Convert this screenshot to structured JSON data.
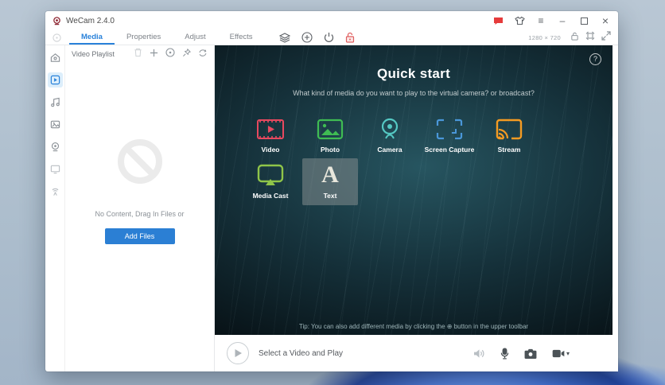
{
  "window": {
    "title": "WeCam 2.4.0",
    "resolution": "1280 × 720",
    "controls": {
      "minimize": "–",
      "maximize": "",
      "close": "×",
      "menu": "≡"
    }
  },
  "tabs": [
    {
      "label": "Media",
      "active": true
    },
    {
      "label": "Properties",
      "active": false
    },
    {
      "label": "Adjust",
      "active": false
    },
    {
      "label": "Effects",
      "active": false
    }
  ],
  "toolbar_icons": [
    "layers-icon",
    "add-circle-icon",
    "power-icon",
    "lock-red-icon"
  ],
  "playlist": {
    "title": "Video Playlist",
    "header_icons": [
      "trash-icon",
      "plus-icon",
      "record-icon",
      "pin-icon",
      "repeat-icon"
    ],
    "empty_text": "No Content, Drag In Files or",
    "add_button_label": "Add Files"
  },
  "preview": {
    "title": "Quick start",
    "subtitle": "What kind of media do you want to play to the virtual camera? or broadcast?",
    "tip": "Tip: You can also add different media by clicking the ⊕ button in the upper toolbar",
    "help_label": "?",
    "media_types": [
      {
        "label": "Video",
        "icon": "film-icon",
        "color": "#e8495f",
        "selected": false
      },
      {
        "label": "Photo",
        "icon": "photo-icon",
        "color": "#3fbc53",
        "selected": false
      },
      {
        "label": "Camera",
        "icon": "webcam-icon",
        "color": "#55c9c4",
        "selected": false
      },
      {
        "label": "Screen Capture",
        "icon": "screen-capture-icon",
        "color": "#4a97d9",
        "selected": false
      },
      {
        "label": "Stream",
        "icon": "stream-icon",
        "color": "#f59b22",
        "selected": false
      },
      {
        "label": "Media Cast",
        "icon": "cast-icon",
        "color": "#8fc549",
        "selected": false
      },
      {
        "label": "Text",
        "icon": "text-icon",
        "color": "#e9e7dc",
        "selected": true,
        "glyph": "A"
      }
    ]
  },
  "bottom_bar": {
    "status": "Select a Video and Play",
    "icons": [
      "speaker-muted-icon",
      "microphone-icon",
      "snapshot-camera-icon",
      "video-camera-icon"
    ]
  },
  "colors": {
    "accent_blue": "#2a82da",
    "add_button": "#2b7fd4",
    "lock_red": "#e06060",
    "preview_bg": "#0a161b"
  }
}
